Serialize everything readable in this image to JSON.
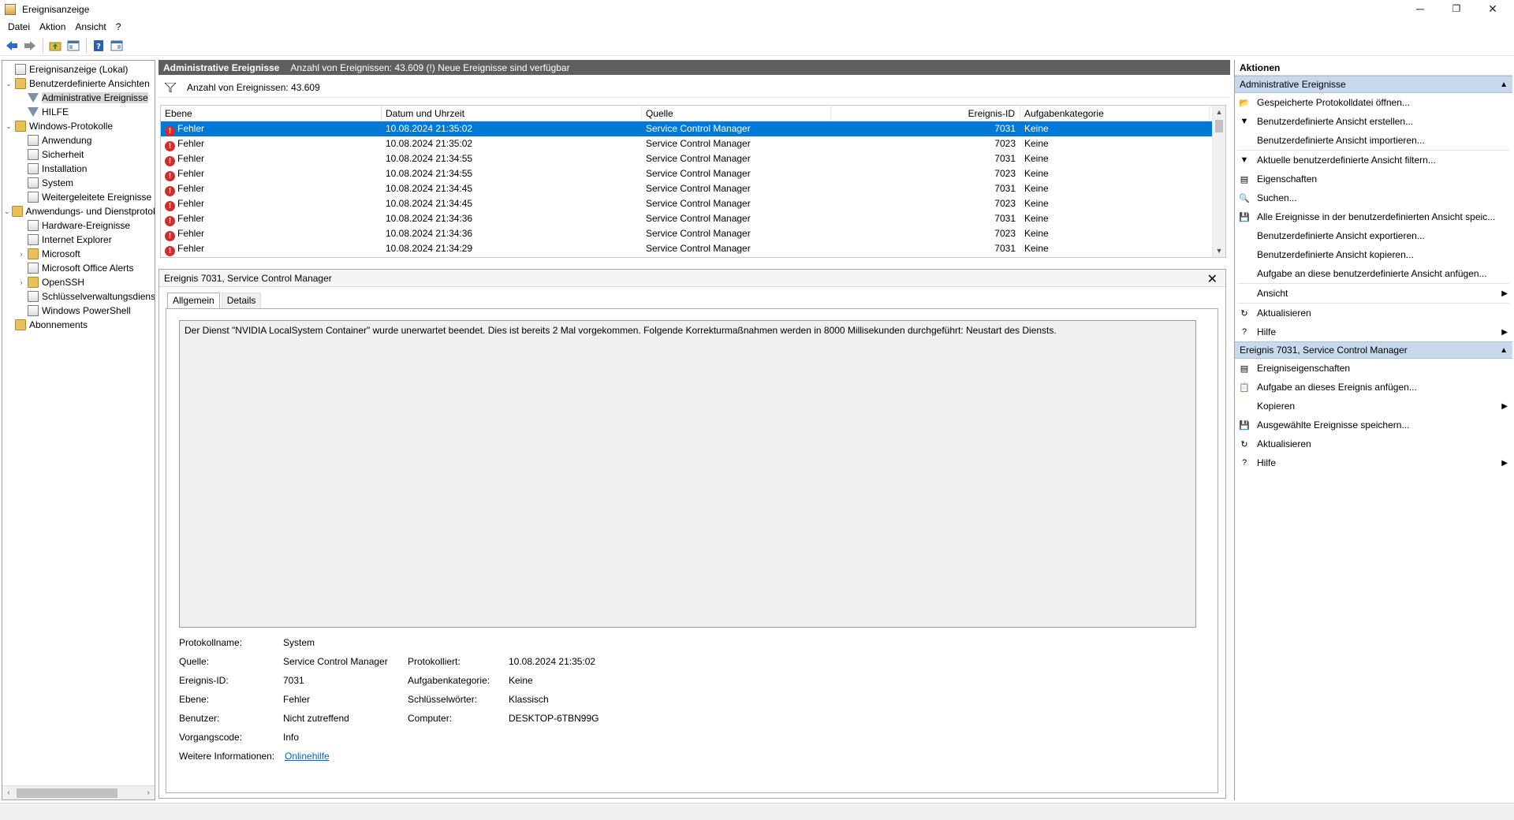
{
  "window": {
    "title": "Ereignisanzeige",
    "minimize": "─",
    "restore": "❐",
    "close": "✕"
  },
  "menu": [
    "Datei",
    "Aktion",
    "Ansicht",
    "?"
  ],
  "tree": {
    "root": "Ereignisanzeige (Lokal)",
    "custom_views": "Benutzerdefinierte Ansichten",
    "admin_events": "Administrative Ereignisse",
    "hilfe": "HILFE",
    "windows_logs": "Windows-Protokolle",
    "anwendung": "Anwendung",
    "sicherheit": "Sicherheit",
    "installation": "Installation",
    "system": "System",
    "weitergeleitet": "Weitergeleitete Ereignisse",
    "app_services": "Anwendungs- und Dienstprotokolle",
    "hardware": "Hardware-Ereignisse",
    "ie": "Internet Explorer",
    "microsoft": "Microsoft",
    "office": "Microsoft Office Alerts",
    "openssh": "OpenSSH",
    "keymgmt": "Schlüsselverwaltungsdienst",
    "powershell": "Windows PowerShell",
    "abonnements": "Abonnements"
  },
  "center": {
    "header_title": "Administrative Ereignisse",
    "header_info": "Anzahl von Ereignissen: 43.609 (!) Neue Ereignisse sind verfügbar",
    "filter_info": "Anzahl von Ereignissen: 43.609",
    "columns": [
      "Ebene",
      "Datum und Uhrzeit",
      "Quelle",
      "Ereignis-ID",
      "Aufgabenkategorie"
    ],
    "rows": [
      {
        "level": "Fehler",
        "date": "10.08.2024 21:35:02",
        "source": "Service Control Manager",
        "id": "7031",
        "cat": "Keine"
      },
      {
        "level": "Fehler",
        "date": "10.08.2024 21:35:02",
        "source": "Service Control Manager",
        "id": "7023",
        "cat": "Keine"
      },
      {
        "level": "Fehler",
        "date": "10.08.2024 21:34:55",
        "source": "Service Control Manager",
        "id": "7031",
        "cat": "Keine"
      },
      {
        "level": "Fehler",
        "date": "10.08.2024 21:34:55",
        "source": "Service Control Manager",
        "id": "7023",
        "cat": "Keine"
      },
      {
        "level": "Fehler",
        "date": "10.08.2024 21:34:45",
        "source": "Service Control Manager",
        "id": "7031",
        "cat": "Keine"
      },
      {
        "level": "Fehler",
        "date": "10.08.2024 21:34:45",
        "source": "Service Control Manager",
        "id": "7023",
        "cat": "Keine"
      },
      {
        "level": "Fehler",
        "date": "10.08.2024 21:34:36",
        "source": "Service Control Manager",
        "id": "7031",
        "cat": "Keine"
      },
      {
        "level": "Fehler",
        "date": "10.08.2024 21:34:36",
        "source": "Service Control Manager",
        "id": "7023",
        "cat": "Keine"
      },
      {
        "level": "Fehler",
        "date": "10.08.2024 21:34:29",
        "source": "Service Control Manager",
        "id": "7031",
        "cat": "Keine"
      }
    ],
    "detail_title": "Ereignis 7031, Service Control Manager",
    "tab_general": "Allgemein",
    "tab_details": "Details",
    "description": "Der Dienst \"NVIDIA LocalSystem Container\" wurde unerwartet beendet. Dies ist bereits 2 Mal vorgekommen. Folgende Korrekturmaßnahmen werden in 8000 Millisekunden durchgeführt: Neustart des Diensts.",
    "props": {
      "protokollname_label": "Protokollname:",
      "protokollname": "System",
      "quelle_label": "Quelle:",
      "quelle": "Service Control Manager",
      "protokolliert_label": "Protokolliert:",
      "protokolliert": "10.08.2024 21:35:02",
      "ereignisid_label": "Ereignis-ID:",
      "ereignisid": "7031",
      "aufgabe_label": "Aufgabenkategorie:",
      "aufgabe": "Keine",
      "ebene_label": "Ebene:",
      "ebene": "Fehler",
      "schluessel_label": "Schlüsselwörter:",
      "schluessel": "Klassisch",
      "benutzer_label": "Benutzer:",
      "benutzer": "Nicht zutreffend",
      "computer_label": "Computer:",
      "computer": "DESKTOP-6TBN99G",
      "vorgang_label": "Vorgangscode:",
      "vorgang": "Info",
      "weitere_label": "Weitere Informationen:",
      "weitere": "Onlinehilfe"
    }
  },
  "actions": {
    "title": "Aktionen",
    "section1": "Administrative Ereignisse",
    "items1": [
      "Gespeicherte Protokolldatei öffnen...",
      "Benutzerdefinierte Ansicht erstellen...",
      "Benutzerdefinierte Ansicht importieren...",
      "Aktuelle benutzerdefinierte Ansicht filtern...",
      "Eigenschaften",
      "Suchen...",
      "Alle Ereignisse in der benutzerdefinierten Ansicht speic...",
      "Benutzerdefinierte Ansicht exportieren...",
      "Benutzerdefinierte Ansicht kopieren...",
      "Aufgabe an diese benutzerdefinierte Ansicht anfügen...",
      "Ansicht",
      "Aktualisieren",
      "Hilfe"
    ],
    "section2": "Ereignis 7031, Service Control Manager",
    "items2": [
      "Ereigniseigenschaften",
      "Aufgabe an dieses Ereignis anfügen...",
      "Kopieren",
      "Ausgewählte Ereignisse speichern...",
      "Aktualisieren",
      "Hilfe"
    ]
  }
}
